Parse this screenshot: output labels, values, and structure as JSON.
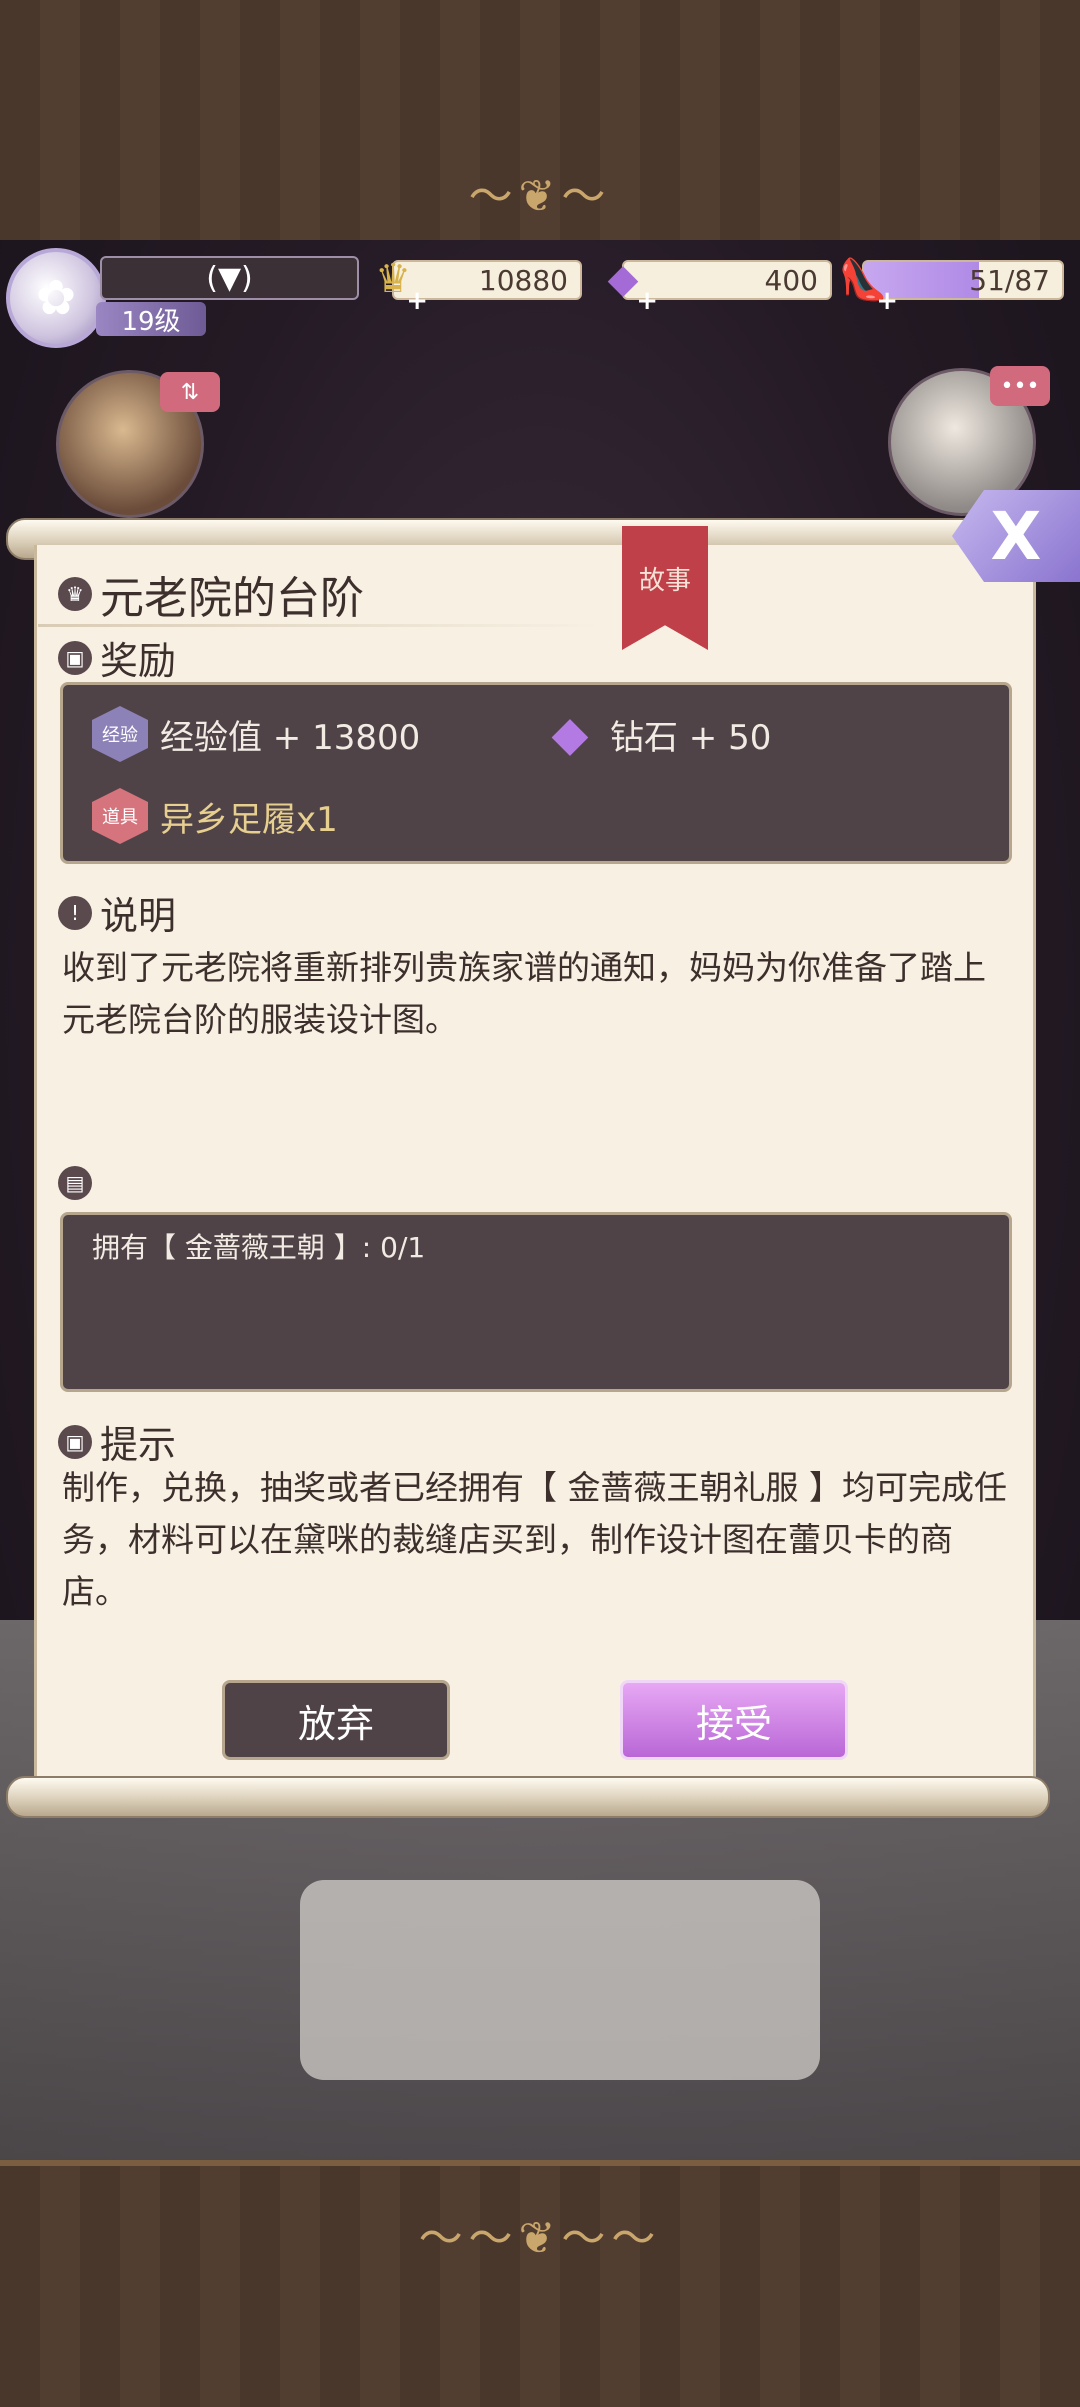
{
  "hud": {
    "dropdown_symbol": "(▼)",
    "level": "19级",
    "gold": "10880",
    "diamonds": "400",
    "energy": "51/87"
  },
  "dialog": {
    "title": "元老院的台阶",
    "ribbon": "故事",
    "close_symbol": "X",
    "rewards_heading": "奖励",
    "rewards": [
      {
        "badge": "经验",
        "text": "经验值 + 13800"
      },
      {
        "badge": "◆",
        "text": "钻石 + 50"
      },
      {
        "badge": "道具",
        "text": "异乡足履x1"
      }
    ],
    "description_heading": "说明",
    "description": "收到了元老院将重新排列贵族家谱的通知，妈妈为你准备了踏上元老院台阶的服装设计图。",
    "requirement": "拥有【 金蔷薇王朝 】: 0/1",
    "hint_heading": "提示",
    "hint": "制作，兑换，抽奖或者已经拥有【 金蔷薇王朝礼服 】均可完成任务，材料可以在黛咪的裁缝店买到，制作设计图在蕾贝卡的商店。",
    "abandon_label": "放弃",
    "accept_label": "接受"
  },
  "colors": {
    "accept": "#c77fe0",
    "paper": "#f7f0e3",
    "dark_box": "#4f4347",
    "ribbon": "#c0404a"
  }
}
